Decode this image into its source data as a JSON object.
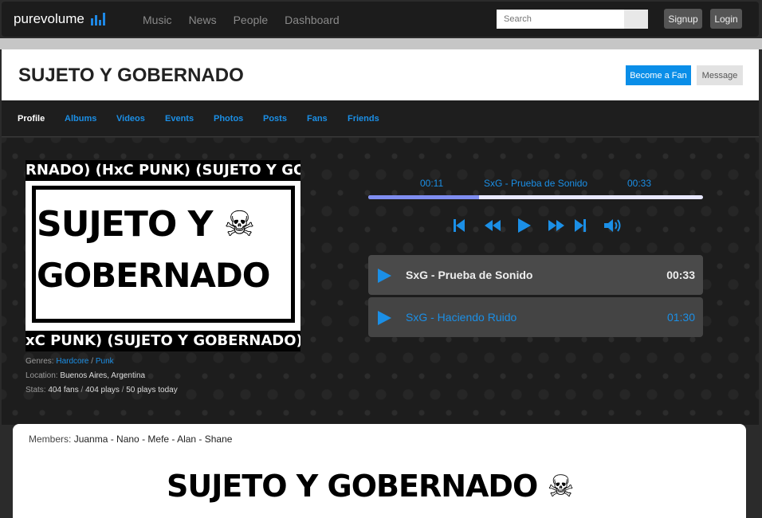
{
  "nav": {
    "logo": "purevolume",
    "links": [
      "Music",
      "News",
      "People",
      "Dashboard"
    ],
    "search_placeholder": "Search",
    "signup": "Signup",
    "login": "Login"
  },
  "colors": {
    "accent": "#1b8fe6",
    "nav_bg": "#1c1c1c",
    "fan_button": "#0a8ee8"
  },
  "header": {
    "title": "SUJETO Y GOBERNADO",
    "fan_button": "Become a Fan",
    "message_button": "Message"
  },
  "tabs": [
    "Profile",
    "Albums",
    "Videos",
    "Events",
    "Photos",
    "Posts",
    "Fans",
    "Friends"
  ],
  "cover": {
    "strip_top": "RNADO) (HxC PUNK) (SUJETO Y GOBE",
    "line1": "SUJETO Y ☠",
    "line2": "GOBERNADO",
    "strip_bottom": "xC PUNK) (SUJETO Y GOBERNADO) (Hx"
  },
  "info": {
    "genres_label": "Genres:",
    "genre1": "Hardcore",
    "genre_sep": "/",
    "genre2": "Punk",
    "location_label": "Location:",
    "location": "Buenos Aires, Argentina",
    "stats_label": "Stats:",
    "fans": "404 fans",
    "stat_sep1": "/",
    "plays": "404 plays",
    "stat_sep2": "/",
    "today": "50 plays today"
  },
  "player": {
    "elapsed": "00:11",
    "now_playing": "SxG - Prueba de Sonido",
    "duration": "00:33",
    "progress": 0.33
  },
  "tracks": [
    {
      "name": "SxG - Prueba de Sonido",
      "duration": "00:33"
    },
    {
      "name": "SxG - Haciendo Ruido",
      "duration": "01:30"
    }
  ],
  "members": {
    "label": "Members:",
    "names": "Juanma - Nano - Mefe - Alan - Shane",
    "logo": "SUJETO Y GOBERNADO ☠"
  }
}
